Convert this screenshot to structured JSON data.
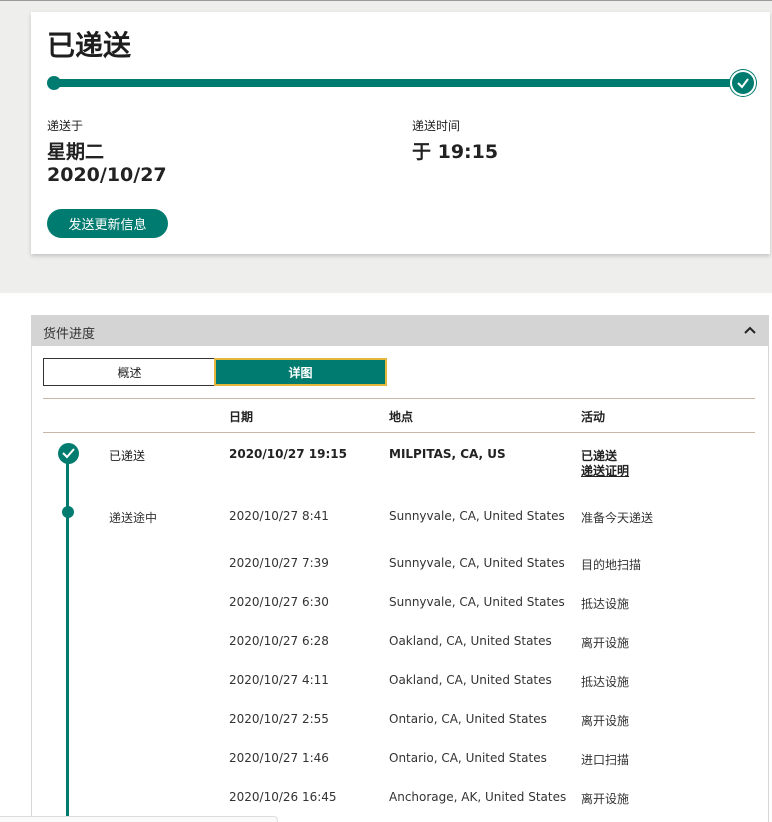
{
  "status": {
    "title": "已递送",
    "delivered_on_label": "递送于",
    "delivered_day": "星期二",
    "delivered_date": "2020/10/27",
    "delivery_time_label": "递送时间",
    "delivery_time": "于 19:15",
    "update_button": "发送更新信息",
    "progress_percent": 100
  },
  "panel": {
    "title": "货件进度",
    "tabs": [
      "概述",
      "详图"
    ],
    "active_tab": "详图",
    "columns": [
      "日期",
      "地点",
      "活动"
    ]
  },
  "events": [
    {
      "status": "已递送",
      "date": "2020/10/27  19:15",
      "location": "MILPITAS, CA, US",
      "activity": "已递送",
      "activity_link": "递送证明"
    },
    {
      "status": "递送途中",
      "date": "2020/10/27  8:41",
      "location": "Sunnyvale, CA, United States",
      "activity": "准备今天递送"
    },
    {
      "status": "",
      "date": "2020/10/27  7:39",
      "location": "Sunnyvale, CA, United States",
      "activity": "目的地扫描"
    },
    {
      "status": "",
      "date": "2020/10/27  6:30",
      "location": "Sunnyvale, CA, United States",
      "activity": "抵达设施"
    },
    {
      "status": "",
      "date": "2020/10/27  6:28",
      "location": "Oakland, CA, United States",
      "activity": "离开设施"
    },
    {
      "status": "",
      "date": "2020/10/27  4:11",
      "location": "Oakland, CA, United States",
      "activity": "抵达设施"
    },
    {
      "status": "",
      "date": "2020/10/27  2:55",
      "location": "Ontario, CA, United States",
      "activity": "离开设施"
    },
    {
      "status": "",
      "date": "2020/10/27  1:46",
      "location": "Ontario, CA, United States",
      "activity": "进口扫描"
    },
    {
      "status": "",
      "date": "2020/10/26  16:45",
      "location": "Anchorage, AK, United States",
      "activity": "离开设施"
    }
  ],
  "colors": {
    "brand": "#007b6f",
    "tab_border": "#e4b73a",
    "header_bg": "#d4d4d4"
  }
}
